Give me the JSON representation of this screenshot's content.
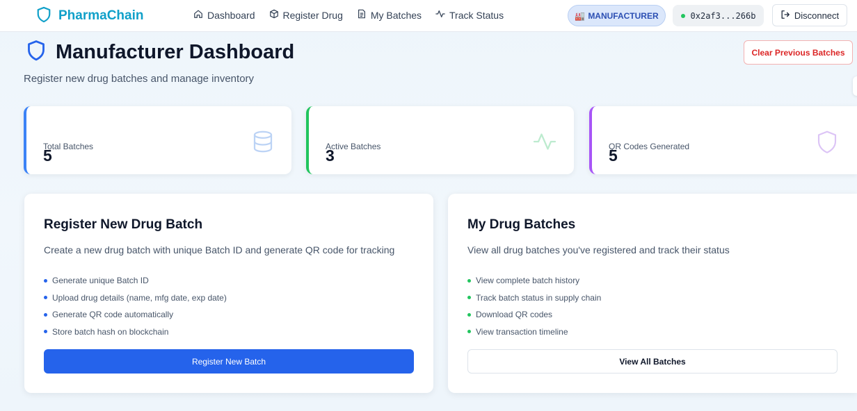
{
  "navbar": {
    "brand": "PharmaChain",
    "links": [
      {
        "label": "Dashboard",
        "icon": "home-icon"
      },
      {
        "label": "Register Drug",
        "icon": "package-icon"
      },
      {
        "label": "My Batches",
        "icon": "document-icon"
      },
      {
        "label": "Track Status",
        "icon": "activity-icon"
      }
    ],
    "role_emoji": "🏭",
    "role": "MANUFACTURER",
    "wallet": "0x2af3...266b",
    "disconnect_label": "Disconnect"
  },
  "header": {
    "title": "Manufacturer Dashboard",
    "subtitle": "Register new drug batches and manage inventory",
    "clear_label": "Clear Previous Batches"
  },
  "stats": [
    {
      "label": "Total Batches",
      "value": "5",
      "icon": "database-icon",
      "accent": "#3b82f6"
    },
    {
      "label": "Active Batches",
      "value": "3",
      "icon": "activity-icon",
      "accent": "#22c55e"
    },
    {
      "label": "QR Codes Generated",
      "value": "5",
      "icon": "shield-icon",
      "accent": "#a855f7"
    }
  ],
  "register_card": {
    "title": "Register New Drug Batch",
    "description": "Create a new drug batch with unique Batch ID and generate QR code for tracking",
    "features": [
      "Generate unique Batch ID",
      "Upload drug details (name, mfg date, exp date)",
      "Generate QR code automatically",
      "Store batch hash on blockchain"
    ],
    "button_label": "Register New Batch",
    "bullet_color": "#2563eb"
  },
  "batches_card": {
    "title": "My Drug Batches",
    "description": "View all drug batches you've registered and track their status",
    "features": [
      "View complete batch history",
      "Track batch status in supply chain",
      "Download QR codes",
      "View transaction timeline"
    ],
    "button_label": "View All Batches",
    "bullet_color": "#22c55e"
  },
  "colors": {
    "brand": "#10a0c9",
    "primary": "#2563eb",
    "danger": "#dc2626",
    "role_badge_bg": "#dbe7fb",
    "wallet_dot": "#22c55e"
  }
}
